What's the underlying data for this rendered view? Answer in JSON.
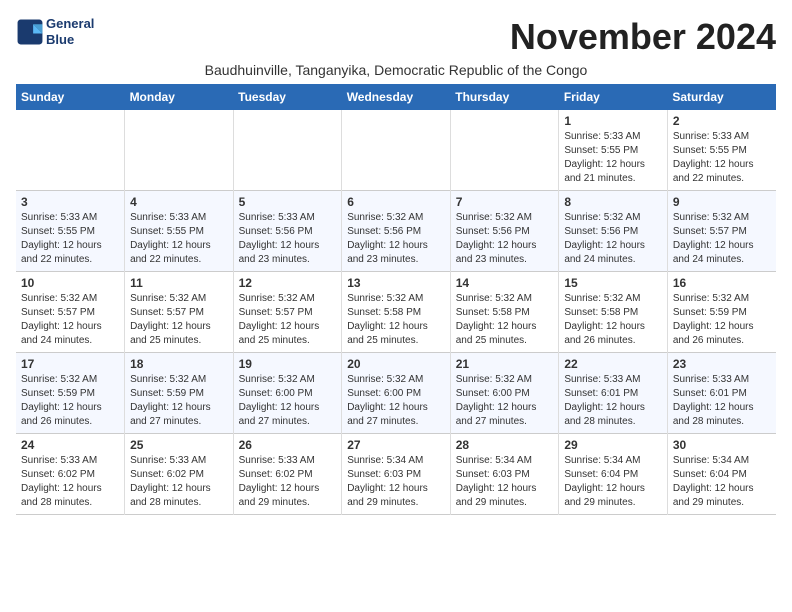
{
  "logo": {
    "line1": "General",
    "line2": "Blue"
  },
  "title": "November 2024",
  "subtitle": "Baudhuinville, Tanganyika, Democratic Republic of the Congo",
  "days_of_week": [
    "Sunday",
    "Monday",
    "Tuesday",
    "Wednesday",
    "Thursday",
    "Friday",
    "Saturday"
  ],
  "weeks": [
    [
      {
        "day": "",
        "info": ""
      },
      {
        "day": "",
        "info": ""
      },
      {
        "day": "",
        "info": ""
      },
      {
        "day": "",
        "info": ""
      },
      {
        "day": "",
        "info": ""
      },
      {
        "day": "1",
        "info": "Sunrise: 5:33 AM\nSunset: 5:55 PM\nDaylight: 12 hours\nand 21 minutes."
      },
      {
        "day": "2",
        "info": "Sunrise: 5:33 AM\nSunset: 5:55 PM\nDaylight: 12 hours\nand 22 minutes."
      }
    ],
    [
      {
        "day": "3",
        "info": "Sunrise: 5:33 AM\nSunset: 5:55 PM\nDaylight: 12 hours\nand 22 minutes."
      },
      {
        "day": "4",
        "info": "Sunrise: 5:33 AM\nSunset: 5:55 PM\nDaylight: 12 hours\nand 22 minutes."
      },
      {
        "day": "5",
        "info": "Sunrise: 5:33 AM\nSunset: 5:56 PM\nDaylight: 12 hours\nand 23 minutes."
      },
      {
        "day": "6",
        "info": "Sunrise: 5:32 AM\nSunset: 5:56 PM\nDaylight: 12 hours\nand 23 minutes."
      },
      {
        "day": "7",
        "info": "Sunrise: 5:32 AM\nSunset: 5:56 PM\nDaylight: 12 hours\nand 23 minutes."
      },
      {
        "day": "8",
        "info": "Sunrise: 5:32 AM\nSunset: 5:56 PM\nDaylight: 12 hours\nand 24 minutes."
      },
      {
        "day": "9",
        "info": "Sunrise: 5:32 AM\nSunset: 5:57 PM\nDaylight: 12 hours\nand 24 minutes."
      }
    ],
    [
      {
        "day": "10",
        "info": "Sunrise: 5:32 AM\nSunset: 5:57 PM\nDaylight: 12 hours\nand 24 minutes."
      },
      {
        "day": "11",
        "info": "Sunrise: 5:32 AM\nSunset: 5:57 PM\nDaylight: 12 hours\nand 25 minutes."
      },
      {
        "day": "12",
        "info": "Sunrise: 5:32 AM\nSunset: 5:57 PM\nDaylight: 12 hours\nand 25 minutes."
      },
      {
        "day": "13",
        "info": "Sunrise: 5:32 AM\nSunset: 5:58 PM\nDaylight: 12 hours\nand 25 minutes."
      },
      {
        "day": "14",
        "info": "Sunrise: 5:32 AM\nSunset: 5:58 PM\nDaylight: 12 hours\nand 25 minutes."
      },
      {
        "day": "15",
        "info": "Sunrise: 5:32 AM\nSunset: 5:58 PM\nDaylight: 12 hours\nand 26 minutes."
      },
      {
        "day": "16",
        "info": "Sunrise: 5:32 AM\nSunset: 5:59 PM\nDaylight: 12 hours\nand 26 minutes."
      }
    ],
    [
      {
        "day": "17",
        "info": "Sunrise: 5:32 AM\nSunset: 5:59 PM\nDaylight: 12 hours\nand 26 minutes."
      },
      {
        "day": "18",
        "info": "Sunrise: 5:32 AM\nSunset: 5:59 PM\nDaylight: 12 hours\nand 27 minutes."
      },
      {
        "day": "19",
        "info": "Sunrise: 5:32 AM\nSunset: 6:00 PM\nDaylight: 12 hours\nand 27 minutes."
      },
      {
        "day": "20",
        "info": "Sunrise: 5:32 AM\nSunset: 6:00 PM\nDaylight: 12 hours\nand 27 minutes."
      },
      {
        "day": "21",
        "info": "Sunrise: 5:32 AM\nSunset: 6:00 PM\nDaylight: 12 hours\nand 27 minutes."
      },
      {
        "day": "22",
        "info": "Sunrise: 5:33 AM\nSunset: 6:01 PM\nDaylight: 12 hours\nand 28 minutes."
      },
      {
        "day": "23",
        "info": "Sunrise: 5:33 AM\nSunset: 6:01 PM\nDaylight: 12 hours\nand 28 minutes."
      }
    ],
    [
      {
        "day": "24",
        "info": "Sunrise: 5:33 AM\nSunset: 6:02 PM\nDaylight: 12 hours\nand 28 minutes."
      },
      {
        "day": "25",
        "info": "Sunrise: 5:33 AM\nSunset: 6:02 PM\nDaylight: 12 hours\nand 28 minutes."
      },
      {
        "day": "26",
        "info": "Sunrise: 5:33 AM\nSunset: 6:02 PM\nDaylight: 12 hours\nand 29 minutes."
      },
      {
        "day": "27",
        "info": "Sunrise: 5:34 AM\nSunset: 6:03 PM\nDaylight: 12 hours\nand 29 minutes."
      },
      {
        "day": "28",
        "info": "Sunrise: 5:34 AM\nSunset: 6:03 PM\nDaylight: 12 hours\nand 29 minutes."
      },
      {
        "day": "29",
        "info": "Sunrise: 5:34 AM\nSunset: 6:04 PM\nDaylight: 12 hours\nand 29 minutes."
      },
      {
        "day": "30",
        "info": "Sunrise: 5:34 AM\nSunset: 6:04 PM\nDaylight: 12 hours\nand 29 minutes."
      }
    ]
  ]
}
